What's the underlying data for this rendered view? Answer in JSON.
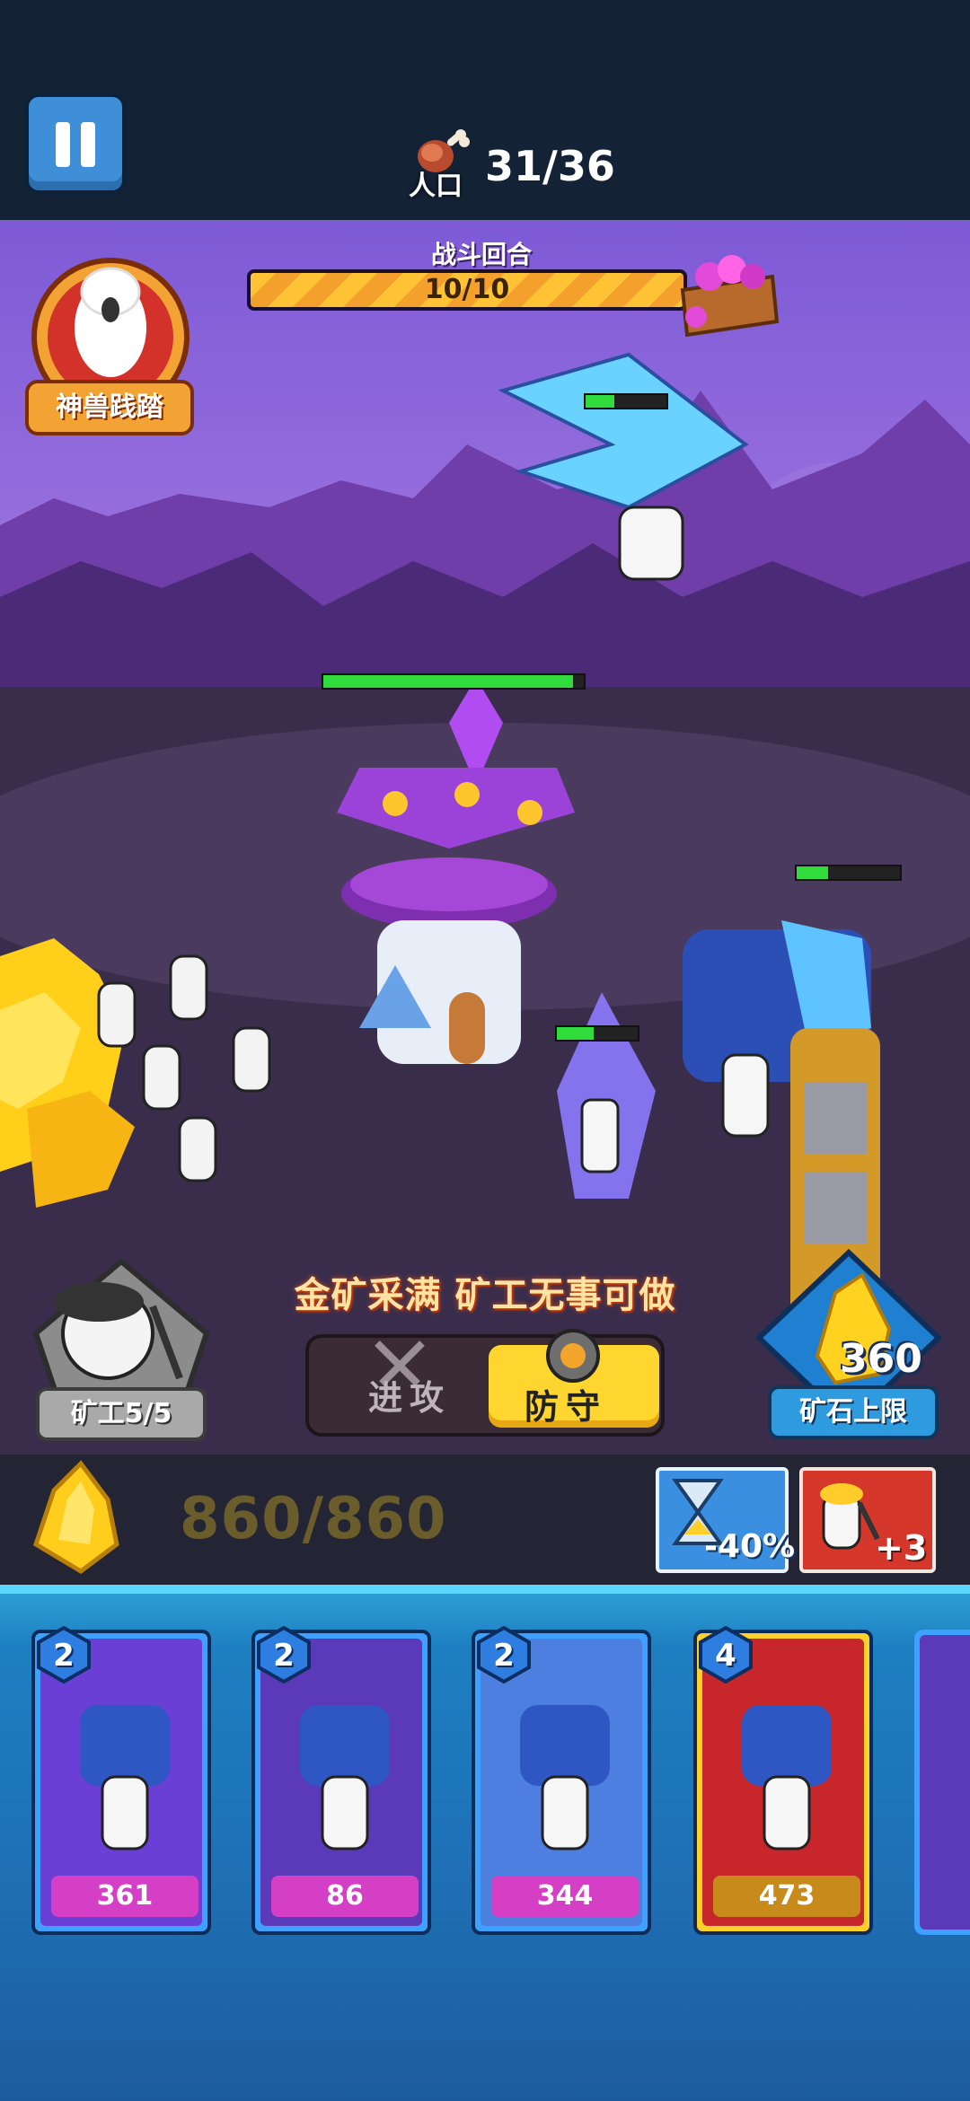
{
  "hud": {
    "population_label": "人口",
    "population": "31/36"
  },
  "battle": {
    "round_title": "战斗回合",
    "round_progress": "10/10",
    "round_fraction": 1.0,
    "skill_label": "神兽践踏",
    "status_message": "金矿采满 矿工无事可做",
    "miner_label": "矿工5/5",
    "mode": {
      "attack_label": "进攻",
      "defend_label": "防守",
      "selected": "defend"
    },
    "ore_cap_value": "360",
    "ore_cap_label": "矿石上限",
    "health": {
      "glider_enemy": 0.35,
      "tower": 0.96,
      "archer_enemy": 0.45,
      "golem_enemy": 0.3
    }
  },
  "resources": {
    "ore_amount": "860/860",
    "boost_time_text": "-40%",
    "boost_miner_text": "+3"
  },
  "cards": [
    {
      "cost": "2",
      "price": "361",
      "unit_icon": "crystal-golem-icon",
      "frame": "#3ea0ff",
      "art": "#6a3fd6",
      "price_bg": "#d43fc6"
    },
    {
      "cost": "2",
      "price": "86",
      "unit_icon": "crystal-archer-icon",
      "frame": "#3ea0ff",
      "art": "#5a3ab8",
      "price_bg": "#d43fc6"
    },
    {
      "cost": "2",
      "price": "344",
      "unit_icon": "crystal-glider-icon",
      "frame": "#3ea0ff",
      "art": "#4d7fe0",
      "price_bg": "#d43fc6"
    },
    {
      "cost": "4",
      "price": "473",
      "unit_icon": "nuke-rocket-icon",
      "frame": "#ffcf2c",
      "art": "#c7262a",
      "price_bg": "#c98a1c"
    }
  ],
  "colors": {
    "hud_bg": "#142236",
    "tray_bg": "#1f6eb4",
    "accent_yellow": "#ffd62f",
    "health_green": "#2fdc3c"
  }
}
